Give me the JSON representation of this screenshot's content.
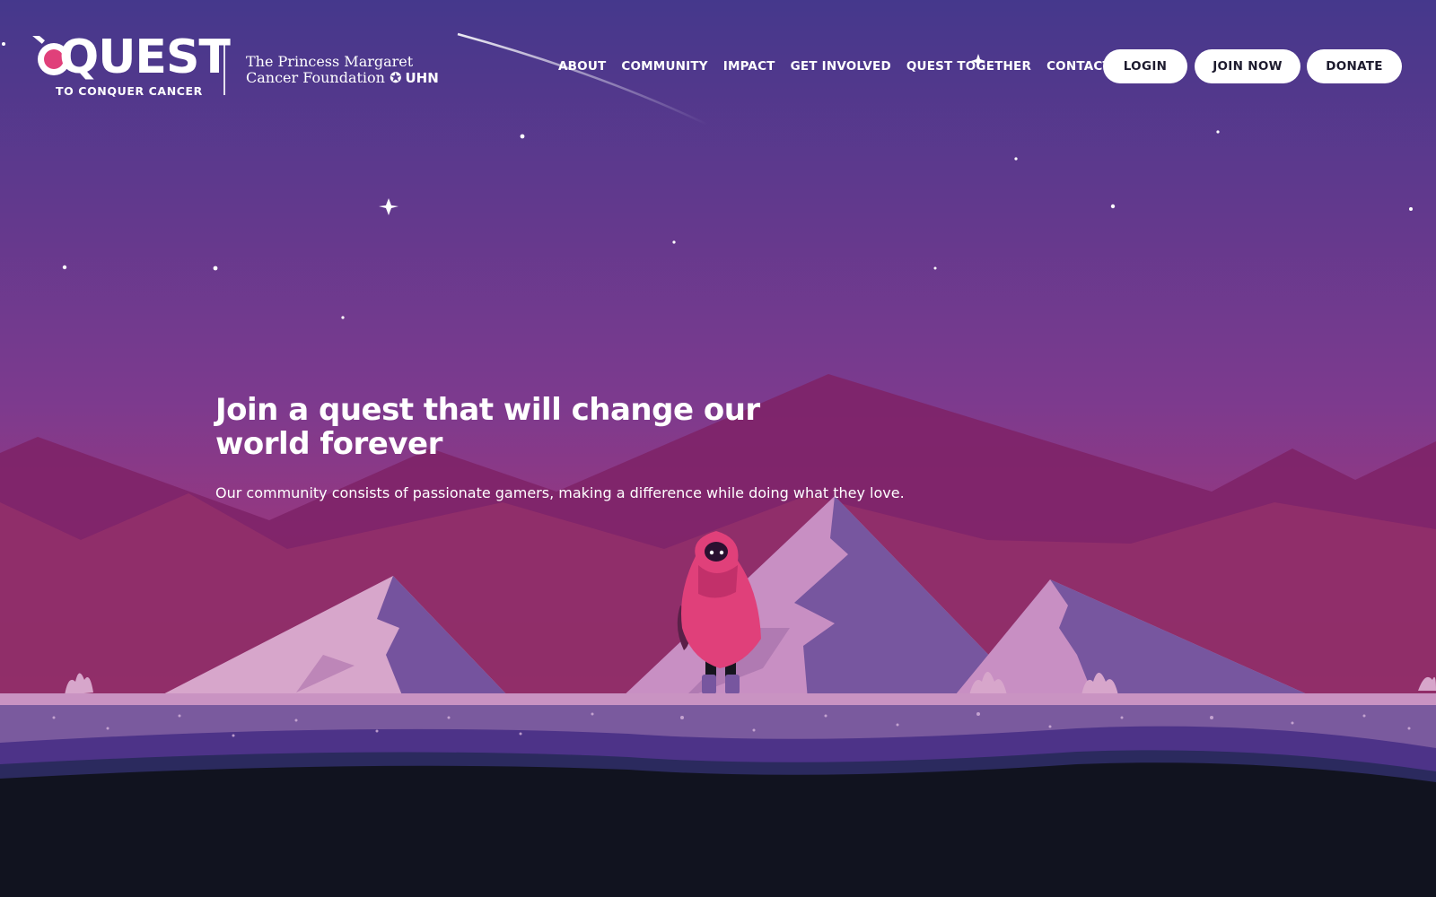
{
  "brand": {
    "logo_word": "QUEST",
    "logo_tagline": "TO CONQUER CANCER",
    "partner_line1": "The Princess Margaret",
    "partner_line2": "Cancer Foundation",
    "partner_uhn": "UHN"
  },
  "nav": {
    "items": [
      {
        "label": "ABOUT"
      },
      {
        "label": "COMMUNITY"
      },
      {
        "label": "IMPACT"
      },
      {
        "label": "GET INVOLVED"
      },
      {
        "label": "QUEST TOGETHER"
      },
      {
        "label": "CONTACT"
      }
    ]
  },
  "actions": {
    "login": "LOGIN",
    "join": "JOIN NOW",
    "donate": "DONATE"
  },
  "hero": {
    "title_line1": "Join a quest that will change our",
    "title_line2": "world forever",
    "subtitle": "Our community consists of passionate gamers, making a difference while doing what they love."
  },
  "colors": {
    "sky_top": "#45388c",
    "sky_bottom": "#b6356e",
    "accent_pink": "#e0407a",
    "ground_purple": "#7a5a9e",
    "footer_dark": "#11131f"
  },
  "icons": {
    "logo_mark": "magnifier-sword-icon",
    "uhn_mark": "uhn-swirl-icon"
  }
}
